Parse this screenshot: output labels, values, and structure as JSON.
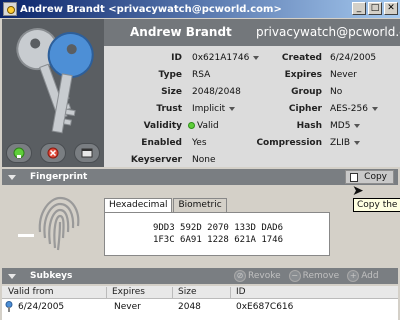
{
  "window": {
    "title": "Andrew Brandt <privacywatch@pcworld.com>",
    "controls": {
      "minimize": "_",
      "maximize": "□",
      "close": "✕"
    }
  },
  "header": {
    "name": "Andrew Brandt",
    "email": "privacywatch@pcworld.c..."
  },
  "icons": {
    "keys": "keys-icon",
    "buttons": [
      "key-export-icon",
      "delete-key-icon",
      "window-icon"
    ]
  },
  "properties": {
    "left": [
      {
        "label": "ID",
        "value": "0x621A1746",
        "dropdown": true
      },
      {
        "label": "Type",
        "value": "RSA"
      },
      {
        "label": "Size",
        "value": "2048/2048"
      },
      {
        "label": "Trust",
        "value": "Implicit",
        "dropdown": true
      },
      {
        "label": "Validity",
        "value": "Valid",
        "status_dot": true
      },
      {
        "label": "Enabled",
        "value": "Yes"
      },
      {
        "label": "Keyserver",
        "value": "None"
      }
    ],
    "right": [
      {
        "label": "Created",
        "value": "6/24/2005"
      },
      {
        "label": "Expires",
        "value": "Never"
      },
      {
        "label": "Group",
        "value": "No"
      },
      {
        "label": "Cipher",
        "value": "AES-256",
        "dropdown": true
      },
      {
        "label": "Hash",
        "value": "MD5",
        "dropdown": true
      },
      {
        "label": "Compression",
        "value": "ZLIB",
        "dropdown": true
      }
    ]
  },
  "fingerprint": {
    "section_label": "Fingerprint",
    "copy_label": "Copy",
    "tooltip": "Copy the F",
    "tabs": [
      "Hexadecimal",
      "Biometric"
    ],
    "line1": "9DD3 592D 2070 133D DAD6",
    "line2": "1F3C 6A91 1228 621A 1746"
  },
  "subkeys": {
    "section_label": "Subkeys",
    "actions": [
      "Revoke",
      "Remove",
      "Add"
    ],
    "columns": [
      "Valid from",
      "Expires",
      "Size",
      "ID"
    ],
    "rows": [
      {
        "valid_from": "6/24/2005",
        "expires": "Never",
        "size": "2048",
        "id": "0xE687C616"
      }
    ]
  },
  "colors": {
    "titlebar_start": "#0a246a",
    "titlebar_end": "#a6caf0",
    "header_band": "#73777b",
    "valid_dot": "#5fcf3a",
    "tooltip_bg": "#ffffe1"
  }
}
